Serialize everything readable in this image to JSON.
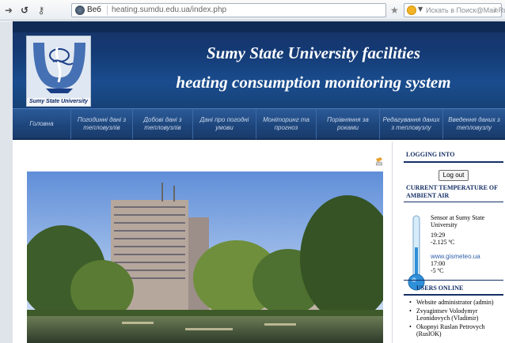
{
  "browser": {
    "site_label": "Веб",
    "url": "heating.sumdu.edu.ua/index.php",
    "search_placeholder": "Искать в Поиск@Mail.Ru"
  },
  "header": {
    "logo_caption": "Sumy State University",
    "title_line1": "Sumy State University facilities",
    "title_line2": "heating consumption monitoring system"
  },
  "menu": [
    "Головна",
    "Погодинні дані з тепловузлів",
    "Добові дані з тепловузлів",
    "Дані про погодні умови",
    "Моніторинг та прогноз",
    "Порівняння за роками",
    "Редагування даних з тепловузлу",
    "Введення даних з тепловузлу"
  ],
  "sidebar": {
    "logging_title": "LOGGING INTO",
    "logout_label": "Log out",
    "temperature_title": "CURRENT TEMPERATURE OF AMBIENT AIR",
    "sensor_location": "Sensor at Sumy State University",
    "sensor_time": "19:29",
    "sensor_value": "-2.125 ºC",
    "gismeteo_site": "www.gismeteo.ua",
    "gismeteo_time": "17:00",
    "gismeteo_value": "-5 ºC",
    "users_title": "USERS ONLINE",
    "users": [
      "Website administrator (admin)",
      "Zvyagintsev Volodymyr Leonidovych (Vladimir)",
      "Okopnyi Ruslan Petrovych (RuslOK)"
    ]
  },
  "colors": {
    "header_blue": "#143a74",
    "menu_blue": "#1e467c",
    "sidebar_heading": "#142f66",
    "link_blue": "#2f5ea8"
  },
  "icons": [
    "back-arrow-icon",
    "forward-arrow-icon",
    "reload-icon",
    "key-icon",
    "bookmark-star-icon",
    "print-icon",
    "thermometer-icon"
  ]
}
